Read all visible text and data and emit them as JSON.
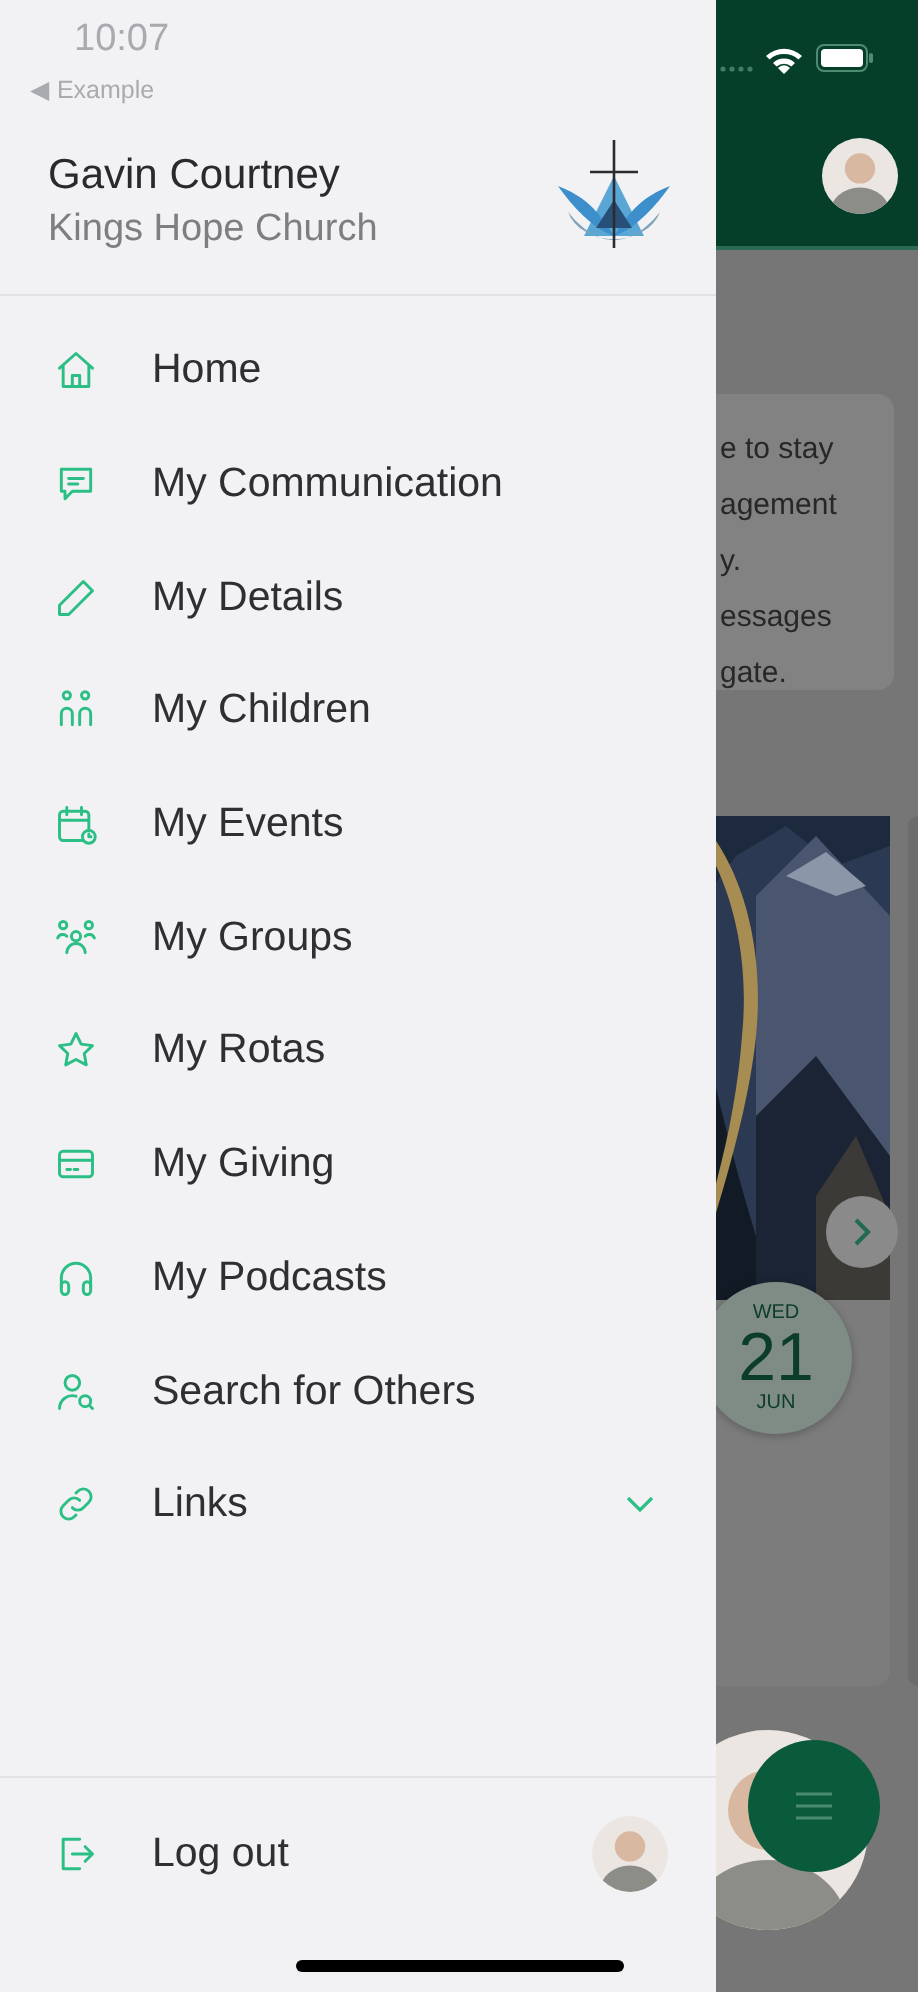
{
  "status_bar": {
    "time": "10:07",
    "back_link": "◀ Example"
  },
  "drawer": {
    "user": {
      "name": "Gavin Courtney",
      "church": "Kings Hope Church"
    },
    "items": [
      {
        "label": "Home",
        "kind": "link"
      },
      {
        "label": "My Communication",
        "kind": "link"
      },
      {
        "label": "My Details",
        "kind": "link"
      },
      {
        "label": "My Children",
        "kind": "link"
      },
      {
        "label": "My Events",
        "kind": "link"
      },
      {
        "label": "My Groups",
        "kind": "link"
      },
      {
        "label": "My Rotas",
        "kind": "link"
      },
      {
        "label": "My Giving",
        "kind": "link"
      },
      {
        "label": "My Podcasts",
        "kind": "link"
      },
      {
        "label": "Search for Others",
        "kind": "link"
      },
      {
        "label": "Links",
        "kind": "expander",
        "expanded": false
      }
    ],
    "footer": {
      "label": "Log out"
    }
  },
  "background_screen": {
    "card_text": [
      "e to stay",
      "agement",
      "y.",
      "essages",
      "gate."
    ],
    "event": {
      "weekday": "WED",
      "day": "21",
      "month": "JUN"
    }
  }
}
